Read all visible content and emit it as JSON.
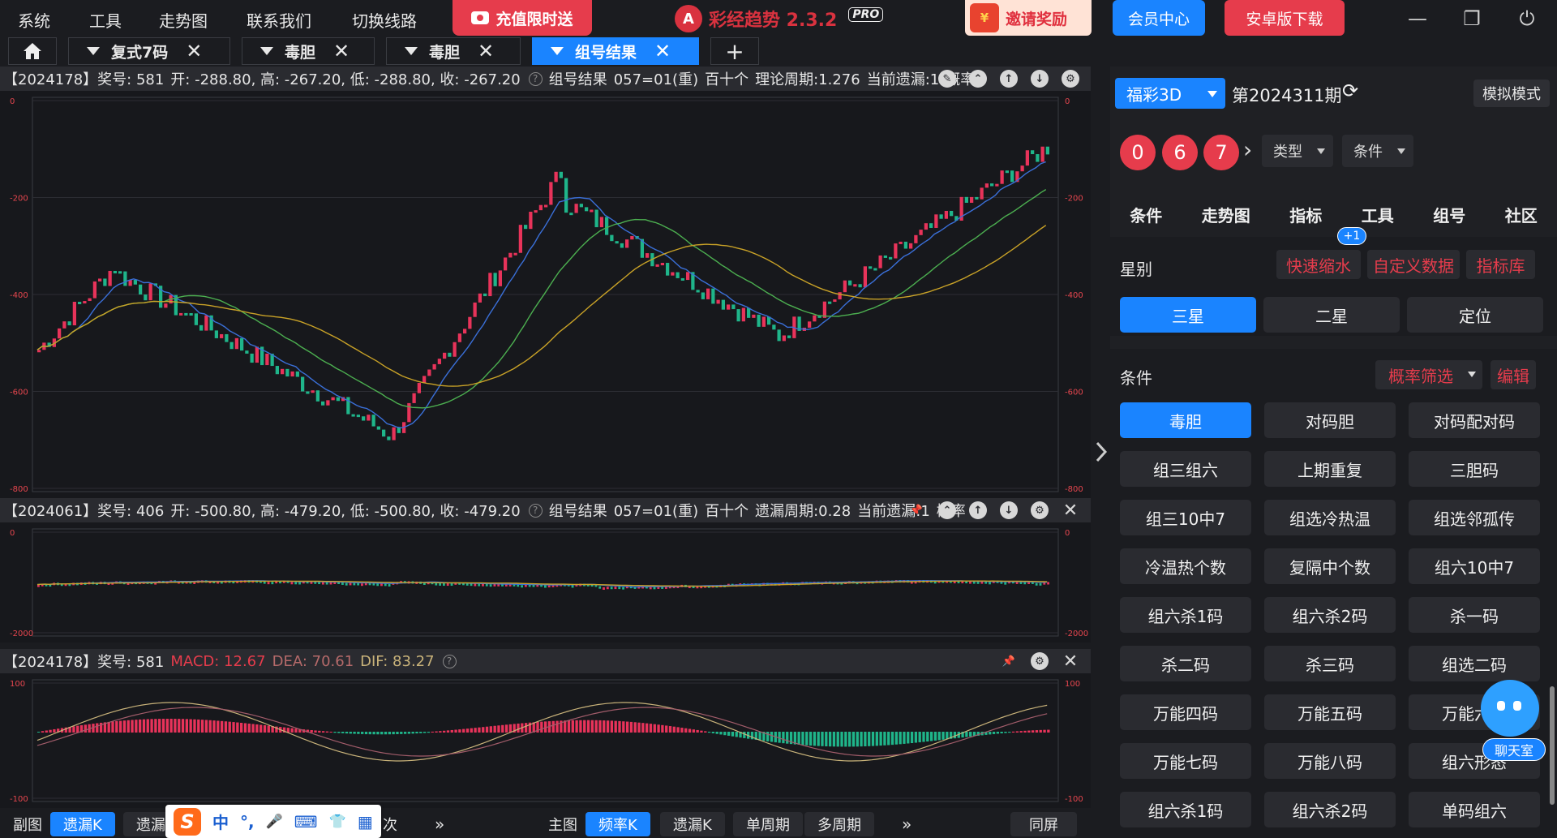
{
  "menu": [
    "系统",
    "工具",
    "走势图",
    "联系我们",
    "切换线路"
  ],
  "promo": {
    "label": "充值限时送"
  },
  "brand": {
    "name": "彩经趋势 2.3.2",
    "badge": "PRO",
    "logo_glyph": "A"
  },
  "invite": {
    "label": "邀请奖励",
    "icon_text": "¥"
  },
  "member_center": "会员中心",
  "android_download": "安卓版下载",
  "window_controls": {
    "minimize": "—",
    "restore": "❐",
    "power": "⏻"
  },
  "tabs": [
    {
      "label": "复式7码",
      "active": false
    },
    {
      "label": "毒胆",
      "active": false
    },
    {
      "label": "毒胆",
      "active": false
    },
    {
      "label": "组号结果",
      "active": true
    }
  ],
  "tab_add": "+",
  "tab_close": "✕",
  "pane1": {
    "header": [
      "【2024178】奖号: 581",
      "开: -288.80, 高: -267.20, 低: -288.80, 收: -267.20"
    ],
    "header2": [
      "组号结果",
      "057=01(重)",
      "百十个",
      "理论周期:1.276",
      "当前遗漏:1",
      "概率"
    ],
    "y_ticks": [
      "0",
      "-200",
      "-400",
      "-600",
      "-800"
    ]
  },
  "pane2": {
    "header": [
      "【2024061】奖号: 406",
      "开: -500.80, 高: -479.20, 低: -500.80, 收: -479.20"
    ],
    "header2": [
      "组号结果",
      "057=01(重)",
      "百十个",
      "遗漏周期:0.28",
      "当前遗漏:1",
      "概率"
    ],
    "y_ticks": [
      "0",
      "-2000"
    ]
  },
  "pane3": {
    "header": [
      "【2024178】奖号: 581"
    ],
    "macd": {
      "macd": "MACD: 12.67",
      "dea": "DEA: 70.61",
      "dif": "DIF: 83.27"
    },
    "y_ticks": [
      "100",
      "-100"
    ]
  },
  "bottom": {
    "sub_label": "副图",
    "sub_buttons": [
      "遗漏K",
      "遗漏K"
    ],
    "sub_more": "»",
    "sub_tail": "次",
    "main_label": "主图",
    "main_buttons": [
      "频率K",
      "遗漏K",
      "单周期",
      "多周期"
    ],
    "main_more": "»",
    "same_screen": "同屏"
  },
  "ime": {
    "logo": "S",
    "items": [
      "中",
      "°,",
      "🎤",
      "⌨",
      "👕",
      "▦"
    ]
  },
  "right": {
    "game": "福彩3D",
    "issue": "第2024311期",
    "sim_mode": "模拟模式",
    "balls": [
      "0",
      "6",
      "7"
    ],
    "type_dd": "类型",
    "cond_dd": "条件",
    "nav": [
      "条件",
      "走势图",
      "指标",
      "工具",
      "组号",
      "社区"
    ],
    "star_label": "星别",
    "quick": "快速缩水",
    "badge": "+1",
    "custom": "自定义数据",
    "indicator_lib": "指标库",
    "stars": [
      {
        "label": "三星",
        "on": true
      },
      {
        "label": "二星",
        "on": false
      },
      {
        "label": "定位",
        "on": false
      }
    ],
    "cond_label": "条件",
    "prob_filter": "概率筛选",
    "edit": "编辑",
    "conditions": [
      [
        "毒胆",
        "对码胆",
        "对码配对码"
      ],
      [
        "组三组六",
        "上期重复",
        "三胆码"
      ],
      [
        "组三10中7",
        "组选冷热温",
        "组选邻孤传"
      ],
      [
        "冷温热个数",
        "复隔中个数",
        "组六10中7"
      ],
      [
        "组六杀1码",
        "组六杀2码",
        "杀一码"
      ],
      [
        "杀二码",
        "杀三码",
        "组选二码"
      ],
      [
        "万能四码",
        "万能五码",
        "万能六码"
      ],
      [
        "万能七码",
        "万能八码",
        "组六形态"
      ],
      [
        "组六杀1码",
        "组六杀2码",
        "单码组六"
      ]
    ],
    "chat": "聊天室"
  },
  "colors": {
    "accent": "#1a84ff",
    "red": "#e63c4c",
    "up": "#e8335a",
    "down": "#1fb58a",
    "ma1": "#3a6fd8",
    "ma2": "#4caf50",
    "ma3": "#c9a227"
  }
}
